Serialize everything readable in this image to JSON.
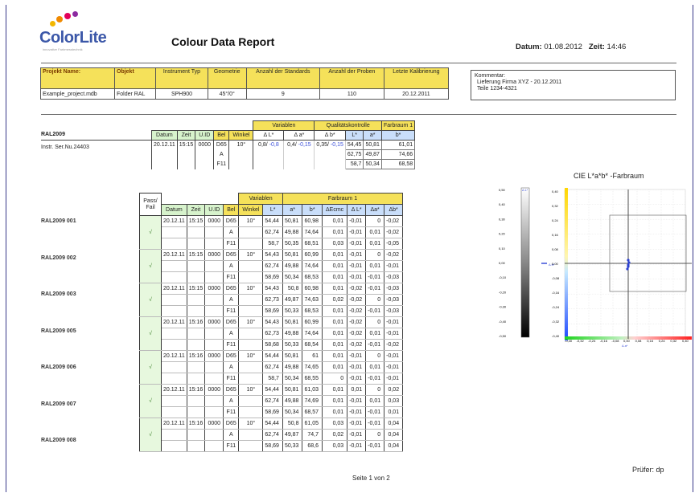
{
  "brand": {
    "name": "ColorLite",
    "tagline": "innovative Farbmesstechnik"
  },
  "header": {
    "title": "Colour Data Report",
    "date_label": "Datum:",
    "date_value": "01.08.2012",
    "time_label": "Zeit:",
    "time_value": "14:46"
  },
  "project": {
    "headers": [
      "Projekt Name:",
      "Objekt",
      "Instrument Typ",
      "Geometrie",
      "Anzahl der Standards",
      "Anzahl der Proben",
      "Letzte Kalibrierung"
    ],
    "values": [
      "Example_project.mdb",
      "Folder RAL",
      "SPH900",
      "45°/0°",
      "9",
      "110",
      "20.12.2011"
    ]
  },
  "comment": {
    "label": "Kommentar:",
    "lines": [
      "Lieferung Firma  XYZ - 20.12.2011",
      "Teile 1234-4321"
    ]
  },
  "standard": {
    "name": "RAL2009",
    "instrument": "Instr. Ser.Nu.24403",
    "group_variables": "Variablen",
    "group_qc": "Qualitätskontrolle",
    "group_space": "Farbraum 1",
    "col_headers": [
      "Datum",
      "Zeit",
      "U.ID",
      "Bel",
      "Winkel",
      "Δ L*",
      "Δ a*",
      "Δ b*",
      "L*",
      "a*",
      "b*"
    ],
    "date": "20.12.11",
    "time": "15:15",
    "uid": "0000",
    "angle": "10°",
    "qc": {
      "dL": "0,8/",
      "dL2": "-0,8",
      "da": "0,4/",
      "da2": "-0,15",
      "db": "0,35/",
      "db2": "-0,15"
    },
    "rows": [
      {
        "illum": "D65",
        "L": "54,45",
        "a": "50,81",
        "b": "61,01"
      },
      {
        "illum": "A",
        "L": "62,75",
        "a": "49,87",
        "b": "74,66"
      },
      {
        "illum": "F11",
        "L": "58,7",
        "a": "50,34",
        "b": "68,58"
      }
    ]
  },
  "samples_table": {
    "pass_header": [
      "Pass/",
      "Fail"
    ],
    "group_variables": "Variablen",
    "group_space": "Farbraum 1",
    "col_headers": [
      "Datum",
      "Zeit",
      "U.ID",
      "Bel",
      "Winkel",
      "L*",
      "a*",
      "b*",
      "ΔEcmc",
      "Δ L*",
      "Δa*",
      "Δb*"
    ],
    "samples": [
      {
        "name": "RAL2009 001",
        "pass": "√",
        "date": "20.12.11",
        "time": "15:15",
        "uid": "0000",
        "angle": "10°",
        "rows": [
          [
            "D65",
            "54,44",
            "50,81",
            "60,98",
            "0,01",
            "-0,01",
            "0",
            "-0,02"
          ],
          [
            "A",
            "62,74",
            "49,88",
            "74,64",
            "0,01",
            "-0,01",
            "0,01",
            "-0,02"
          ],
          [
            "F11",
            "58,7",
            "50,35",
            "68,51",
            "0,03",
            "-0,01",
            "0,01",
            "-0,05"
          ]
        ]
      },
      {
        "name": "RAL2009 002",
        "pass": "√",
        "date": "20.12.11",
        "time": "15:15",
        "uid": "0000",
        "angle": "10°",
        "rows": [
          [
            "D65",
            "54,43",
            "50,81",
            "60,99",
            "0,01",
            "-0,01",
            "0",
            "-0,02"
          ],
          [
            "A",
            "62,74",
            "49,88",
            "74,64",
            "0,01",
            "-0,01",
            "0,01",
            "-0,01"
          ],
          [
            "F11",
            "58,69",
            "50,34",
            "68,53",
            "0,01",
            "-0,01",
            "-0,01",
            "-0,03"
          ]
        ]
      },
      {
        "name": "RAL2009 003",
        "pass": "√",
        "date": "20.12.11",
        "time": "15:15",
        "uid": "0000",
        "angle": "10°",
        "rows": [
          [
            "D65",
            "54,43",
            "50,8",
            "60,98",
            "0,01",
            "-0,02",
            "-0,01",
            "-0,03"
          ],
          [
            "A",
            "62,73",
            "49,87",
            "74,63",
            "0,02",
            "-0,02",
            "0",
            "-0,03"
          ],
          [
            "F11",
            "58,69",
            "50,33",
            "68,53",
            "0,01",
            "-0,02",
            "-0,01",
            "-0,03"
          ]
        ]
      },
      {
        "name": "RAL2009 005",
        "pass": "√",
        "date": "20.12.11",
        "time": "15:16",
        "uid": "0000",
        "angle": "10°",
        "rows": [
          [
            "D65",
            "54,43",
            "50,81",
            "60,99",
            "0,01",
            "-0,02",
            "0",
            "-0,01"
          ],
          [
            "A",
            "62,73",
            "49,88",
            "74,64",
            "0,01",
            "-0,02",
            "0,01",
            "-0,01"
          ],
          [
            "F11",
            "58,68",
            "50,33",
            "68,54",
            "0,01",
            "-0,02",
            "-0,01",
            "-0,02"
          ]
        ]
      },
      {
        "name": "RAL2009 006",
        "pass": "√",
        "date": "20.12.11",
        "time": "15:16",
        "uid": "0000",
        "angle": "10°",
        "rows": [
          [
            "D65",
            "54,44",
            "50,81",
            "61",
            "0,01",
            "-0,01",
            "0",
            "-0,01"
          ],
          [
            "A",
            "62,74",
            "49,88",
            "74,65",
            "0,01",
            "-0,01",
            "0,01",
            "-0,01"
          ],
          [
            "F11",
            "58,7",
            "50,34",
            "68,55",
            "0",
            "-0,01",
            "-0,01",
            "-0,01"
          ]
        ]
      },
      {
        "name": "RAL2009 007",
        "pass": "√",
        "date": "20.12.11",
        "time": "15:16",
        "uid": "0000",
        "angle": "10°",
        "rows": [
          [
            "D65",
            "54,44",
            "50,81",
            "61,03",
            "0,01",
            "0,01",
            "0",
            "0,02"
          ],
          [
            "A",
            "62,74",
            "49,88",
            "74,69",
            "0,01",
            "-0,01",
            "0,01",
            "0,03"
          ],
          [
            "F11",
            "58,69",
            "50,34",
            "68,57",
            "0,01",
            "-0,01",
            "-0,01",
            "0,01"
          ]
        ]
      },
      {
        "name": "RAL2009 008",
        "pass": "√",
        "date": "20.12.11",
        "time": "15:16",
        "uid": "0000",
        "angle": "10°",
        "rows": [
          [
            "D65",
            "54,44",
            "50,8",
            "61,05",
            "0,03",
            "-0,01",
            "-0,01",
            "0,04"
          ],
          [
            "A",
            "62,74",
            "49,87",
            "74,7",
            "0,02",
            "-0,01",
            "0",
            "0,04"
          ],
          [
            "F11",
            "58,69",
            "50,33",
            "68,6",
            "0,03",
            "-0,01",
            "-0,01",
            "0,04"
          ]
        ]
      }
    ]
  },
  "cie": {
    "title": "CIE L*a*b* -Farbraum",
    "dl_label": "Δ L*",
    "db_label": "Δ b*",
    "da_label": "Δ a*",
    "dl_ticks": [
      "0,50",
      "0,40",
      "0,30",
      "0,20",
      "0,10",
      "0,00",
      "-0,10",
      "-0,20",
      "-0,30",
      "-0,40",
      "-0,50"
    ],
    "db_ticks": [
      "0,40",
      "0,32",
      "0,24",
      "0,16",
      "0,08",
      "0,00",
      "-0,08",
      "-0,16",
      "-0,24",
      "-0,32",
      "-0,40"
    ],
    "da_ticks": [
      "-0,40",
      "-0,32",
      "-0,24",
      "-0,16",
      "-0,08",
      "0,00",
      "0,08",
      "0,16",
      "0,24",
      "0,32",
      "0,40"
    ]
  },
  "footer": {
    "page": "Seite 1 von 2",
    "examiner": "Prüfer: dp"
  },
  "colors": {
    "header_yellow": "#f5e15a",
    "header_green": "#d7f3cc",
    "header_blue": "#c9defa",
    "accent_blue": "#3b4fd8",
    "brand_blue": "#3b57a8"
  }
}
